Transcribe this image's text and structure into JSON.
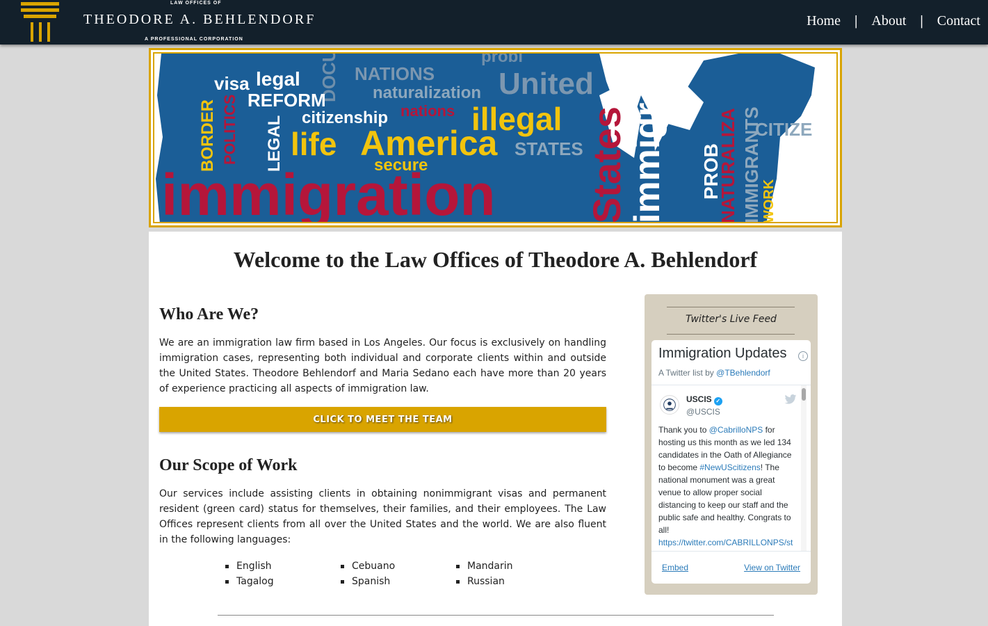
{
  "header": {
    "logo_top": "LAW OFFICES OF",
    "logo_main": "THEODORE A. BEHLENDORF",
    "logo_sub": "A PROFESSIONAL CORPORATION",
    "nav": [
      {
        "label": "Home"
      },
      {
        "label": "About"
      },
      {
        "label": "Contact"
      }
    ],
    "separator": "|",
    "colors": {
      "bar": "#13202b",
      "gold": "#d9a400"
    }
  },
  "banner": {
    "words": [
      "visa",
      "legal",
      "NATIONS",
      "naturalization",
      "REFORM",
      "citizenship",
      "nations",
      "illegal",
      "BORDER",
      "POLITICS",
      "LEGAL",
      "life",
      "America",
      "STATES",
      "secure",
      "immigration",
      "United",
      "States",
      "immigr",
      "PROB",
      "NATURALIZA",
      "IMMIGRANTS",
      "CITIZE",
      "WORK",
      "DOCU",
      "probl"
    ]
  },
  "main": {
    "welcome": "Welcome to the Law Offices of Theodore A. Behlendorf",
    "who_heading": "Who Are We?",
    "who_text": "We are an immigration law firm based in Los Angeles. Our focus is exclusively on handling immigration cases, representing both individual and corporate clients within and outside the United States. Theodore Behlendorf and Maria Sedano each have more than 20 years of experience practicing all aspects of immigration law.",
    "cta_label": "CLICK TO MEET THE TEAM",
    "scope_heading": "Our Scope of Work",
    "scope_text": "Our services include assisting clients in obtaining nonimmigrant visas and permanent resident (green card) status for themselves, their families, and their employees. The Law Offices represent clients from all over the United States and the world. We are also fluent in the following languages:",
    "languages": [
      "English",
      "Cebuano",
      "Mandarin",
      "Tagalog",
      "Spanish",
      "Russian"
    ]
  },
  "twitter": {
    "panel_title": "Twitter's Live Feed",
    "list_title": "Immigration Updates",
    "list_by": "A Twitter list by",
    "list_owner": "@TBehlendorf",
    "info_glyph": "i",
    "tweet": {
      "name": "USCIS",
      "verified_glyph": "✓",
      "handle": "@USCIS",
      "t1": "Thank you to ",
      "mention": "@CabrilloNPS",
      "t2": " for hosting us this month as we led 134 candidates in the Oath of Allegiance to become ",
      "hashtag": "#NewUScitizens",
      "t3": "! The national monument was a great venue to allow proper social distancing to keep our staff and the public safe and healthy. Congrats to all!",
      "link": "https://twitter.com/CABRILLONPS/st"
    },
    "embed_label": "Embed",
    "view_label": "View on Twitter"
  }
}
